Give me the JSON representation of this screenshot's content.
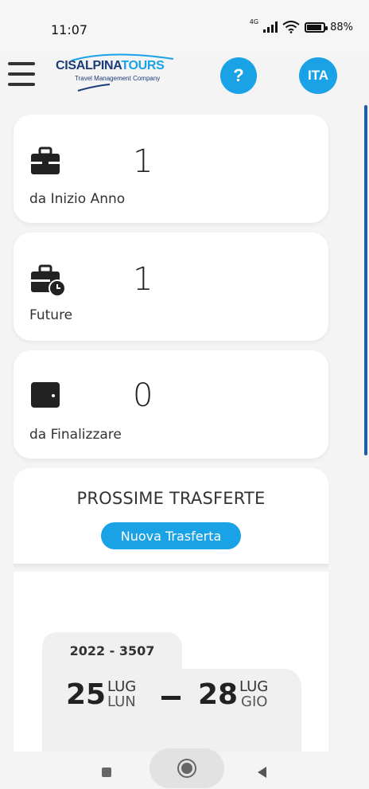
{
  "status_bar": {
    "time": "11:07",
    "network": "4G",
    "battery": "88%"
  },
  "header": {
    "logo_part1": "CISALPINA",
    "logo_part2": "TOURS",
    "logo_tagline": "Travel Management Company",
    "help_label": "?",
    "language_label": "ITA"
  },
  "stats": [
    {
      "icon": "briefcase-icon",
      "value": "1",
      "label": "da Inizio Anno"
    },
    {
      "icon": "briefcase-clock-icon",
      "value": "1",
      "label": "Future"
    },
    {
      "icon": "wallet-icon",
      "value": "0",
      "label": "da Finalizzare"
    }
  ],
  "upcoming": {
    "title": "PROSSIME TRASFERTE",
    "new_button": "Nuova Trasferta"
  },
  "trip": {
    "code": "2022 - 3507",
    "start_day": "25",
    "start_month": "LUG",
    "start_weekday": "LUN",
    "end_day": "28",
    "end_month": "LUG",
    "end_weekday": "GIO"
  },
  "colors": {
    "accent": "#1aa2e6",
    "brand_dark": "#1c3c78"
  }
}
